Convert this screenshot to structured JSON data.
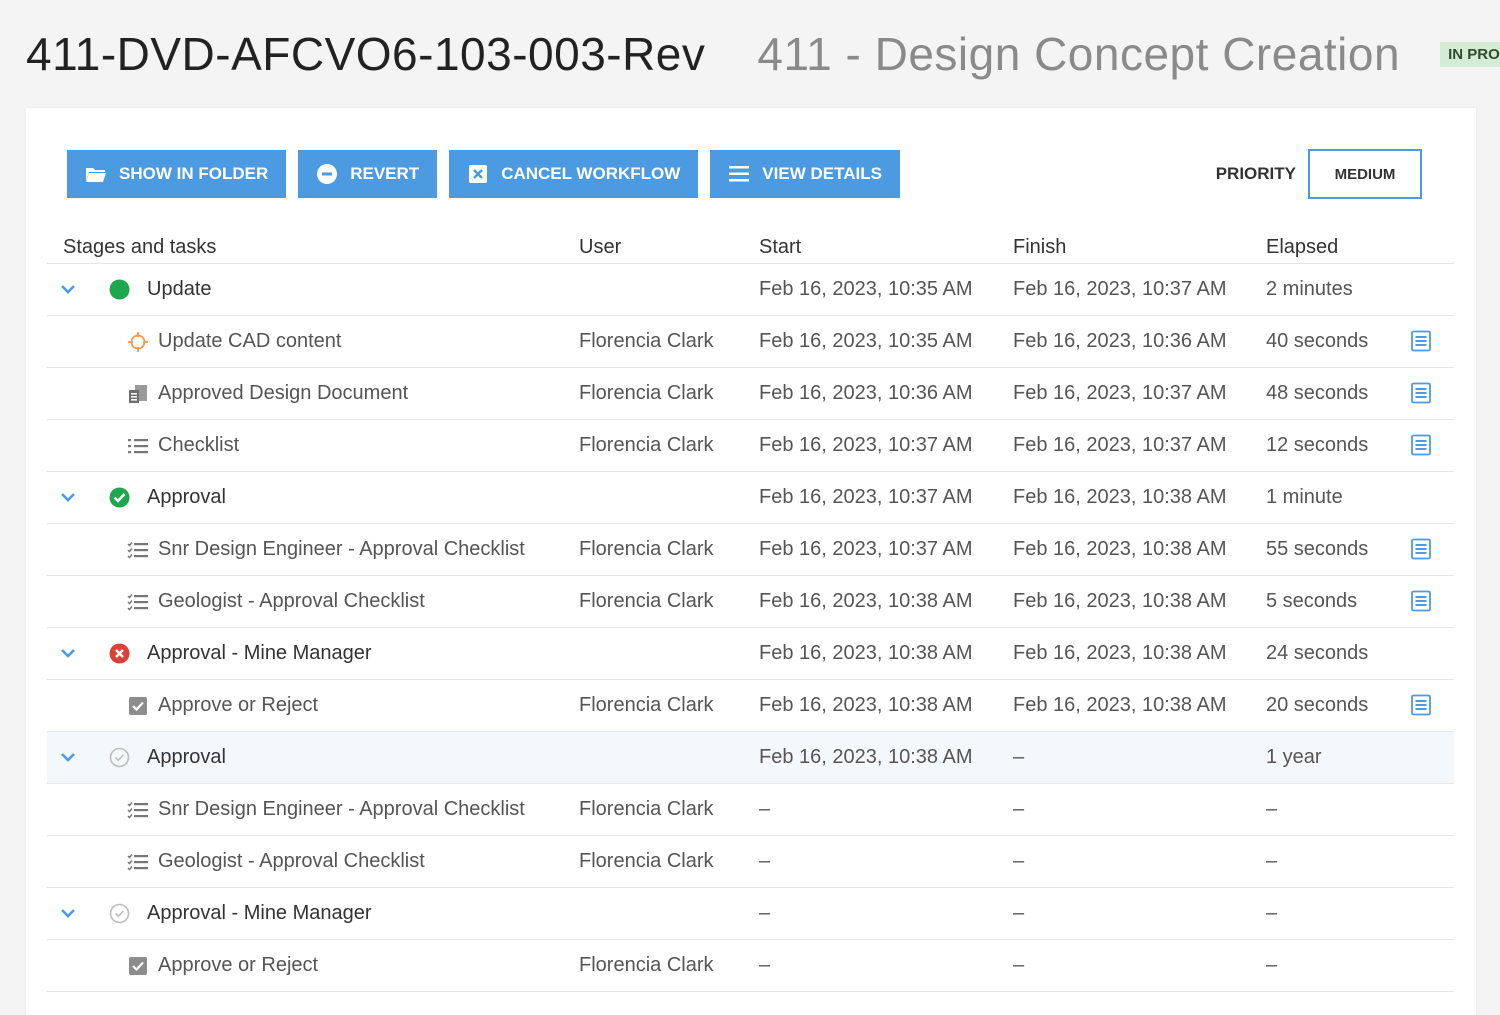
{
  "header": {
    "doc_id": "411-DVD-AFCVO6-103-003-Rev",
    "title": "411 - Design Concept Creation",
    "status": "IN PROGRESS"
  },
  "toolbar": {
    "show_in_folder": "SHOW IN FOLDER",
    "revert": "REVERT",
    "cancel_workflow": "CANCEL WORKFLOW",
    "view_details": "VIEW DETAILS",
    "priority_label": "PRIORITY",
    "priority_value": "MEDIUM"
  },
  "table": {
    "headers": {
      "stages": "Stages and tasks",
      "user": "User",
      "start": "Start",
      "finish": "Finish",
      "elapsed": "Elapsed"
    },
    "rows": [
      {
        "kind": "stage",
        "status": "complete-dot",
        "name": "Update",
        "user": "",
        "start": "Feb 16, 2023, 10:35 AM",
        "finish": "Feb 16, 2023, 10:37 AM",
        "elapsed": "2 minutes"
      },
      {
        "kind": "task",
        "icon": "cad-icon",
        "name": "Update CAD content",
        "user": "Florencia Clark",
        "start": "Feb 16, 2023, 10:35 AM",
        "finish": "Feb 16, 2023, 10:36 AM",
        "elapsed": "40 seconds",
        "details": true
      },
      {
        "kind": "task",
        "icon": "document-icon",
        "name": "Approved Design Document",
        "user": "Florencia Clark",
        "start": "Feb 16, 2023, 10:36 AM",
        "finish": "Feb 16, 2023, 10:37 AM",
        "elapsed": "48 seconds",
        "details": true
      },
      {
        "kind": "task",
        "icon": "list-icon",
        "name": "Checklist",
        "user": "Florencia Clark",
        "start": "Feb 16, 2023, 10:37 AM",
        "finish": "Feb 16, 2023, 10:37 AM",
        "elapsed": "12 seconds",
        "details": true
      },
      {
        "kind": "stage",
        "status": "complete-check",
        "name": "Approval",
        "user": "",
        "start": "Feb 16, 2023, 10:37 AM",
        "finish": "Feb 16, 2023, 10:38 AM",
        "elapsed": "1 minute"
      },
      {
        "kind": "task",
        "icon": "checklist-icon",
        "name": "Snr Design Engineer - Approval Checklist",
        "user": "Florencia Clark",
        "start": "Feb 16, 2023, 10:37 AM",
        "finish": "Feb 16, 2023, 10:38 AM",
        "elapsed": "55 seconds",
        "details": true
      },
      {
        "kind": "task",
        "icon": "checklist-icon",
        "name": "Geologist - Approval Checklist",
        "user": "Florencia Clark",
        "start": "Feb 16, 2023, 10:38 AM",
        "finish": "Feb 16, 2023, 10:38 AM",
        "elapsed": "5 seconds",
        "details": true
      },
      {
        "kind": "stage",
        "status": "rejected",
        "name": "Approval - Mine Manager",
        "user": "",
        "start": "Feb 16, 2023, 10:38 AM",
        "finish": "Feb 16, 2023, 10:38 AM",
        "elapsed": "24 seconds"
      },
      {
        "kind": "task",
        "icon": "checkbox-icon",
        "name": "Approve or Reject",
        "user": "Florencia Clark",
        "start": "Feb 16, 2023, 10:38 AM",
        "finish": "Feb 16, 2023, 10:38 AM",
        "elapsed": "20 seconds",
        "details": true
      },
      {
        "kind": "stage",
        "status": "pending",
        "name": "Approval",
        "user": "",
        "start": "Feb 16, 2023, 10:38 AM",
        "finish": "–",
        "elapsed": "1 year",
        "highlight": true
      },
      {
        "kind": "task",
        "icon": "checklist-icon",
        "name": "Snr Design Engineer - Approval Checklist",
        "user": "Florencia Clark",
        "start": "–",
        "finish": "–",
        "elapsed": "–"
      },
      {
        "kind": "task",
        "icon": "checklist-icon",
        "name": "Geologist - Approval Checklist",
        "user": "Florencia Clark",
        "start": "–",
        "finish": "–",
        "elapsed": "–"
      },
      {
        "kind": "stage",
        "status": "pending",
        "name": "Approval - Mine Manager",
        "user": "",
        "start": "–",
        "finish": "–",
        "elapsed": "–"
      },
      {
        "kind": "task",
        "icon": "checkbox-icon",
        "name": "Approve or Reject",
        "user": "Florencia Clark",
        "start": "–",
        "finish": "–",
        "elapsed": "–"
      }
    ]
  },
  "colors": {
    "accent": "#4c9be2",
    "status_complete": "#1fa74f",
    "status_rejected": "#d9413b",
    "status_pending": "#bdbdbd",
    "badge_bg": "#d4ecd3"
  }
}
